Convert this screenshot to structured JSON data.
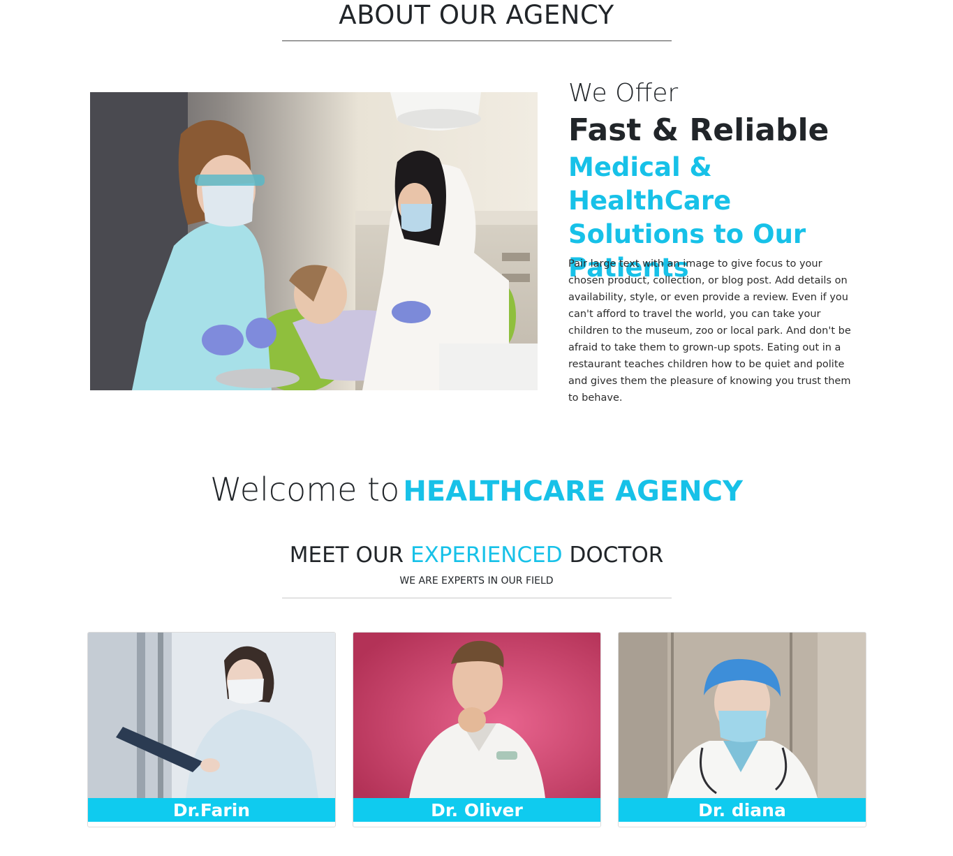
{
  "about": {
    "title": "ABOUT OUR AGENCY"
  },
  "offer": {
    "lead": "We Offer",
    "headline": "Fast & Reliable",
    "highlight": "Medical & HealthCare Solutions to Our Patients",
    "paragraph": "Pair large text with an image to give focus to your chosen product, collection, or blog post. Add details on availability, style, or even provide a review. Even if you can't afford to travel the world, you can take your children to the museum, zoo or local park. And don't be afraid to take them to grown-up spots. Eating out in a restaurant teaches children how to be quiet and polite and gives them the pleasure of knowing you trust them to behave."
  },
  "welcome": {
    "prefix": "Welcome to",
    "brand": "HEALTHCARE AGENCY"
  },
  "doctors_section": {
    "title_start": "MEET OUR",
    "title_accent": "EXPERIENCED",
    "title_end": "DOCTOR",
    "subtitle": "WE ARE EXPERTS IN OUR FIELD"
  },
  "doctors": [
    {
      "name": "Dr.Farin"
    },
    {
      "name": "Dr. Oliver"
    },
    {
      "name": "Dr. diana"
    }
  ],
  "colors": {
    "accent": "#17c1e8",
    "name_bar": "#0fcbef",
    "text": "#212529"
  }
}
